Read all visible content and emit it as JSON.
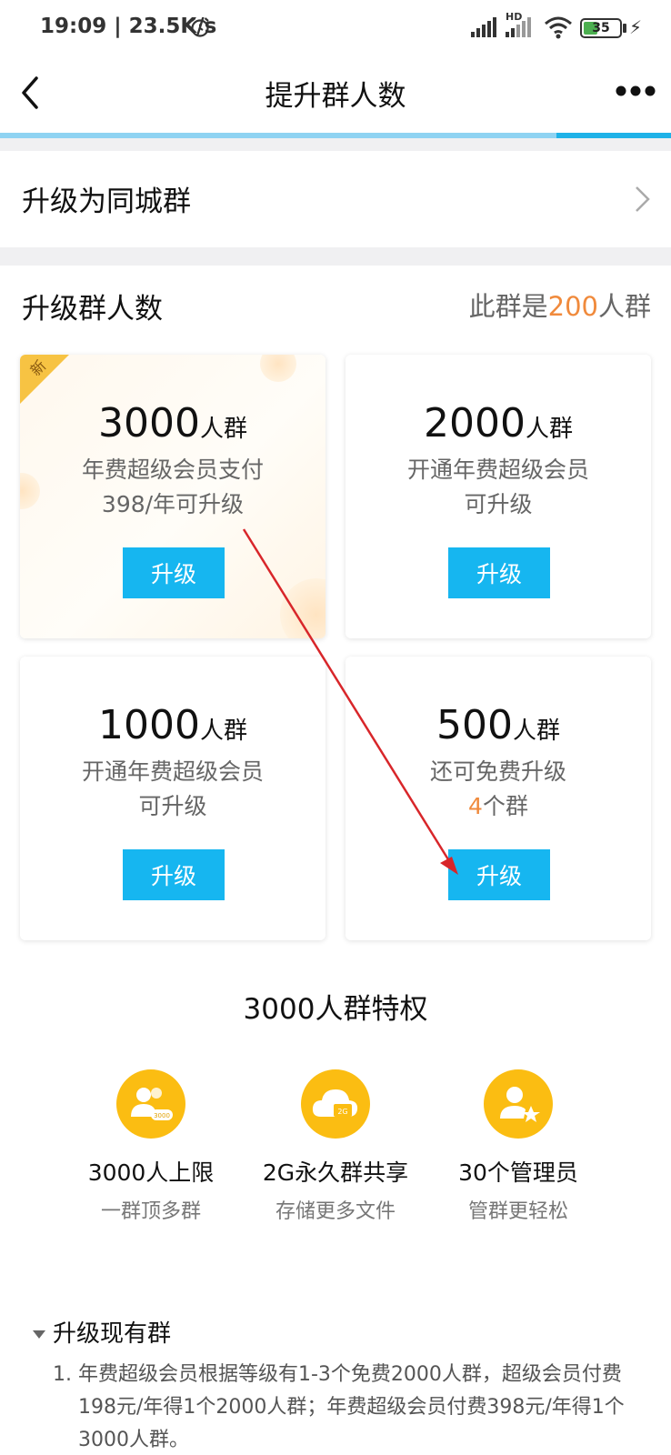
{
  "status": {
    "time": "19:09 | 23.5K/s",
    "network_hd": "HD",
    "battery": "35"
  },
  "nav": {
    "title": "提升群人数"
  },
  "city_upgrade": {
    "label": "升级为同城群"
  },
  "upgrade_section": {
    "title": "升级群人数",
    "note_prefix": "此群是",
    "current_size": "200",
    "note_suffix": "人群"
  },
  "cards": [
    {
      "size": "3000",
      "unit": "人群",
      "desc_line1": "年费超级会员支付",
      "desc_line2": "398/年可升级",
      "button": "升级",
      "badge": "新"
    },
    {
      "size": "2000",
      "unit": "人群",
      "desc_line1": "开通年费超级会员",
      "desc_line2": "可升级",
      "button": "升级"
    },
    {
      "size": "1000",
      "unit": "人群",
      "desc_line1": "开通年费超级会员",
      "desc_line2": "可升级",
      "button": "升级"
    },
    {
      "size": "500",
      "unit": "人群",
      "desc_line1": "还可免费升级",
      "desc_line2_count": "4",
      "desc_line2_suffix": "个群",
      "button": "升级"
    }
  ],
  "privileges": {
    "title": "3000人群特权",
    "items": [
      {
        "name": "3000人上限",
        "sub": "一群顶多群",
        "icon": "group-members-icon",
        "icon_text": "3000"
      },
      {
        "name": "2G永久群共享",
        "sub": "存储更多文件",
        "icon": "cloud-storage-icon",
        "icon_text": "2G"
      },
      {
        "name": "30个管理员",
        "sub": "管群更轻松",
        "icon": "admin-star-icon"
      }
    ]
  },
  "faq": {
    "heading": "升级现有群",
    "items": [
      {
        "index": "1.",
        "text": "年费超级会员根据等级有1-3个免费2000人群，超级会员付费198元/年得1个2000人群；年费超级会员付费398元/年得1个3000人群。"
      }
    ]
  },
  "colors": {
    "accent": "#16b6f0",
    "highlight": "#f08a3c",
    "gold": "#fbbd12",
    "annotation_arrow": "#d8262a"
  }
}
